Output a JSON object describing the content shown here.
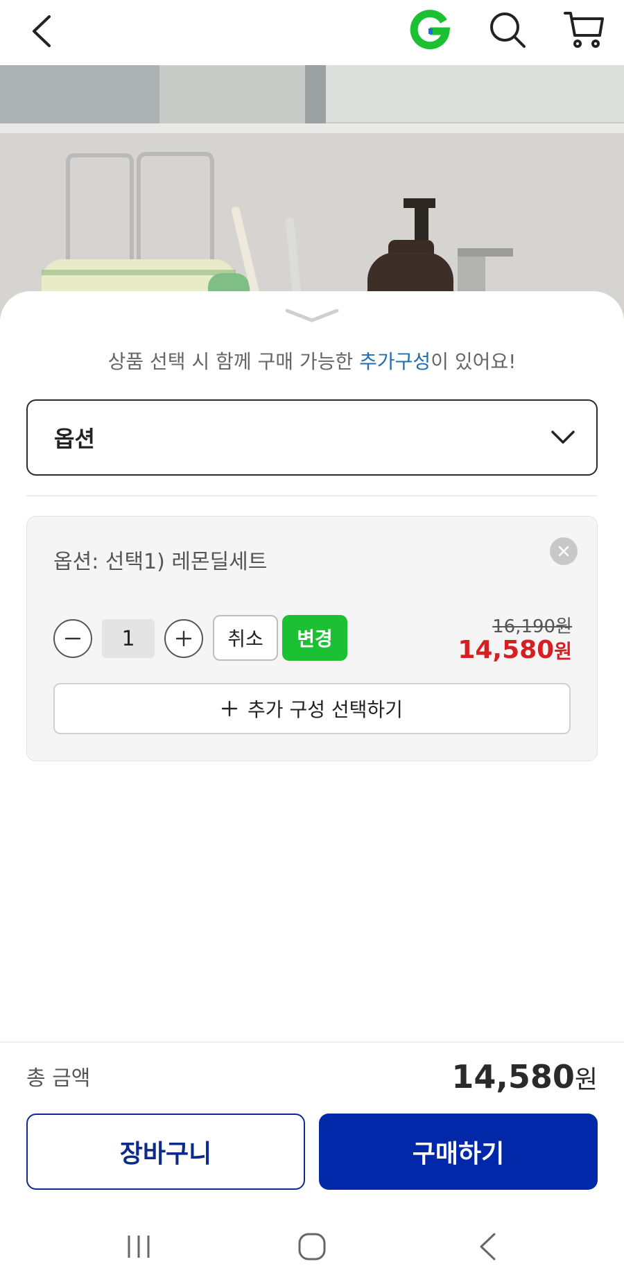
{
  "header": {
    "back_icon": "chevron-left-icon",
    "logo_letter": "G",
    "brand_color": "#1cc133",
    "search_icon": "search-icon",
    "cart_icon": "cart-icon"
  },
  "sheet": {
    "notice_prefix": "상품 선택 시 함께 구매 가능한 ",
    "notice_highlight": "추가구성",
    "notice_suffix": "이 있어요!",
    "option_select_label": "옵션",
    "selected_option": {
      "name": "옵션: 선택1) 레몬딜세트",
      "quantity": "1",
      "cancel_label": "취소",
      "change_label": "변경",
      "original_price": "16,190원",
      "sale_price": "14,580",
      "sale_currency": "원",
      "add_config_label": "추가 구성 선택하기"
    }
  },
  "footer": {
    "total_label": "총 금액",
    "total_amount": "14,580",
    "total_currency": "원",
    "cart_button": "장바구니",
    "buy_button": "구매하기"
  },
  "colors": {
    "accent_green": "#1cc133",
    "sale_red": "#d61f23",
    "buy_blue": "#0028a8",
    "highlight_blue": "#1f6fb2"
  }
}
